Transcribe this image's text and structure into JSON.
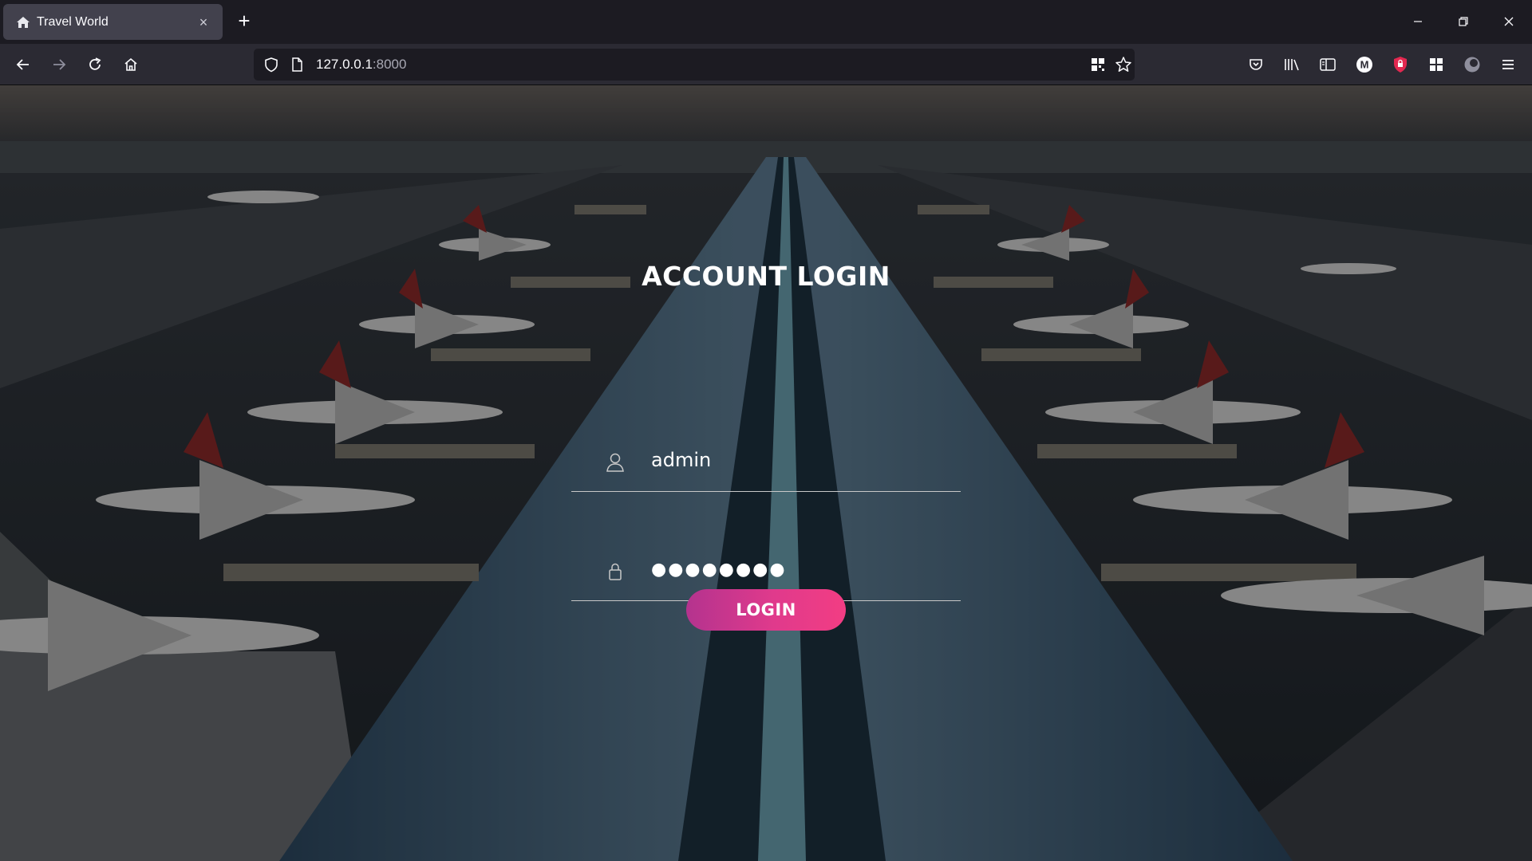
{
  "browser": {
    "tab": {
      "title": "Travel World",
      "close": "×"
    },
    "new_tab": "+",
    "window_controls": {
      "minimize": "minimize-icon",
      "restore": "restore-icon",
      "close": "close-icon"
    },
    "nav": {
      "back": "back-arrow-icon",
      "forward": "forward-arrow-icon",
      "reload": "reload-icon",
      "home": "home-icon"
    },
    "address": {
      "host": "127.0.0.1",
      "port": ":8000"
    },
    "toolbar_icons": [
      "pocket-icon",
      "library-icon",
      "sidebar-icon",
      "account-m-icon",
      "shield-extension-icon",
      "extensions-icon",
      "profile-icon",
      "menu-icon"
    ]
  },
  "login": {
    "title": "ACCOUNT LOGIN",
    "username": {
      "value": "admin",
      "icon": "user-icon"
    },
    "password": {
      "value": "●●●●●●●●",
      "icon": "lock-icon"
    },
    "button": "LOGIN"
  },
  "colors": {
    "button_gradient_start": "#b4338e",
    "button_gradient_end": "#f23d83",
    "tab_bg": "#42414d",
    "toolbar_bg": "#2b2a33"
  }
}
